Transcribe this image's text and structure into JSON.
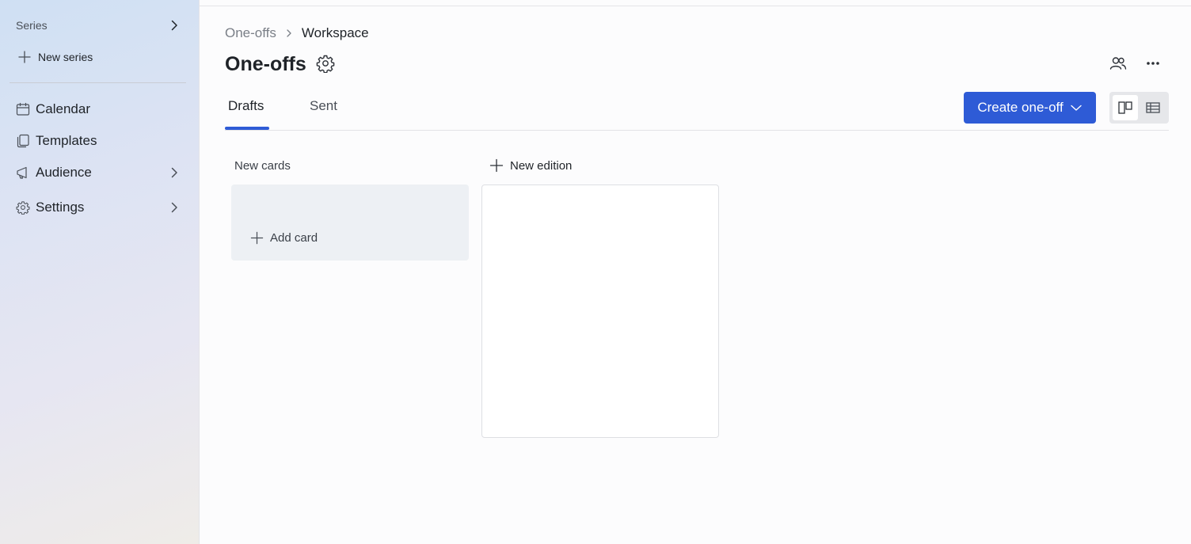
{
  "sidebar": {
    "series_label": "Series",
    "new_series_label": "New series",
    "items": [
      {
        "label": "Calendar",
        "icon": "calendar-icon"
      },
      {
        "label": "Templates",
        "icon": "templates-icon"
      },
      {
        "label": "Audience",
        "icon": "megaphone-icon"
      },
      {
        "label": "Settings",
        "icon": "gear-icon"
      }
    ]
  },
  "breadcrumb": {
    "parent": "One-offs",
    "current": "Workspace"
  },
  "page": {
    "title": "One-offs"
  },
  "tabs": [
    {
      "label": "Drafts",
      "active": true
    },
    {
      "label": "Sent",
      "active": false
    }
  ],
  "toolbar": {
    "create_label": "Create one-off",
    "accent_color": "#2e5bd6"
  },
  "board": {
    "column_title": "New cards",
    "add_card_label": "Add card",
    "new_edition_label": "New edition"
  }
}
